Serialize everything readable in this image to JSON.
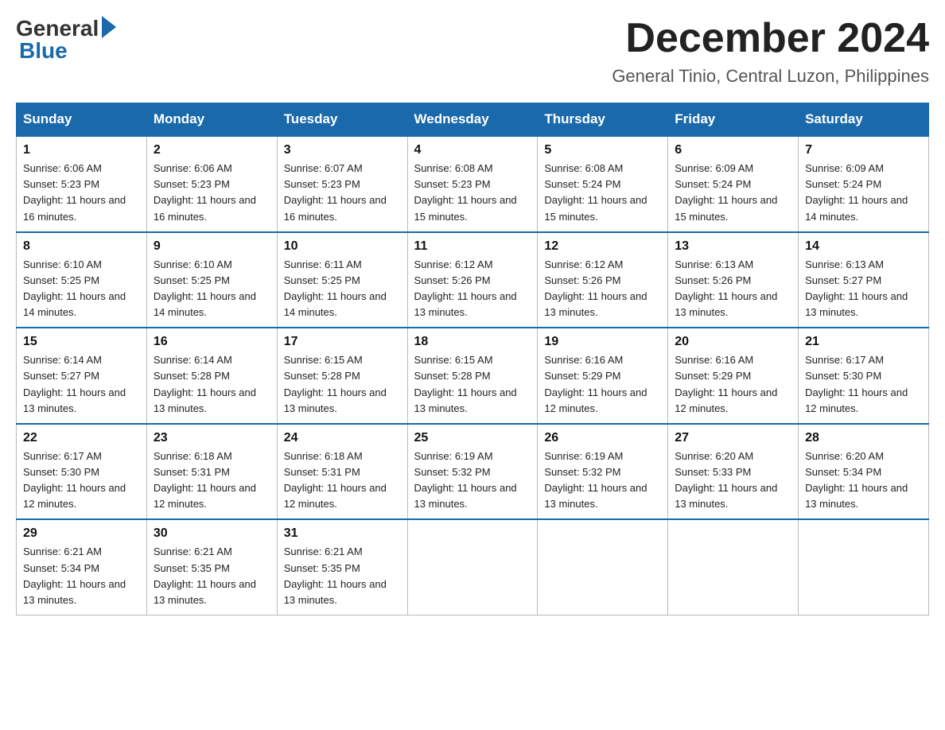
{
  "logo": {
    "general": "General",
    "blue": "Blue"
  },
  "header": {
    "month": "December 2024",
    "location": "General Tinio, Central Luzon, Philippines"
  },
  "days": [
    "Sunday",
    "Monday",
    "Tuesday",
    "Wednesday",
    "Thursday",
    "Friday",
    "Saturday"
  ],
  "weeks": [
    [
      {
        "day": "1",
        "sunrise": "6:06 AM",
        "sunset": "5:23 PM",
        "daylight": "11 hours and 16 minutes."
      },
      {
        "day": "2",
        "sunrise": "6:06 AM",
        "sunset": "5:23 PM",
        "daylight": "11 hours and 16 minutes."
      },
      {
        "day": "3",
        "sunrise": "6:07 AM",
        "sunset": "5:23 PM",
        "daylight": "11 hours and 16 minutes."
      },
      {
        "day": "4",
        "sunrise": "6:08 AM",
        "sunset": "5:23 PM",
        "daylight": "11 hours and 15 minutes."
      },
      {
        "day": "5",
        "sunrise": "6:08 AM",
        "sunset": "5:24 PM",
        "daylight": "11 hours and 15 minutes."
      },
      {
        "day": "6",
        "sunrise": "6:09 AM",
        "sunset": "5:24 PM",
        "daylight": "11 hours and 15 minutes."
      },
      {
        "day": "7",
        "sunrise": "6:09 AM",
        "sunset": "5:24 PM",
        "daylight": "11 hours and 14 minutes."
      }
    ],
    [
      {
        "day": "8",
        "sunrise": "6:10 AM",
        "sunset": "5:25 PM",
        "daylight": "11 hours and 14 minutes."
      },
      {
        "day": "9",
        "sunrise": "6:10 AM",
        "sunset": "5:25 PM",
        "daylight": "11 hours and 14 minutes."
      },
      {
        "day": "10",
        "sunrise": "6:11 AM",
        "sunset": "5:25 PM",
        "daylight": "11 hours and 14 minutes."
      },
      {
        "day": "11",
        "sunrise": "6:12 AM",
        "sunset": "5:26 PM",
        "daylight": "11 hours and 13 minutes."
      },
      {
        "day": "12",
        "sunrise": "6:12 AM",
        "sunset": "5:26 PM",
        "daylight": "11 hours and 13 minutes."
      },
      {
        "day": "13",
        "sunrise": "6:13 AM",
        "sunset": "5:26 PM",
        "daylight": "11 hours and 13 minutes."
      },
      {
        "day": "14",
        "sunrise": "6:13 AM",
        "sunset": "5:27 PM",
        "daylight": "11 hours and 13 minutes."
      }
    ],
    [
      {
        "day": "15",
        "sunrise": "6:14 AM",
        "sunset": "5:27 PM",
        "daylight": "11 hours and 13 minutes."
      },
      {
        "day": "16",
        "sunrise": "6:14 AM",
        "sunset": "5:28 PM",
        "daylight": "11 hours and 13 minutes."
      },
      {
        "day": "17",
        "sunrise": "6:15 AM",
        "sunset": "5:28 PM",
        "daylight": "11 hours and 13 minutes."
      },
      {
        "day": "18",
        "sunrise": "6:15 AM",
        "sunset": "5:28 PM",
        "daylight": "11 hours and 13 minutes."
      },
      {
        "day": "19",
        "sunrise": "6:16 AM",
        "sunset": "5:29 PM",
        "daylight": "11 hours and 12 minutes."
      },
      {
        "day": "20",
        "sunrise": "6:16 AM",
        "sunset": "5:29 PM",
        "daylight": "11 hours and 12 minutes."
      },
      {
        "day": "21",
        "sunrise": "6:17 AM",
        "sunset": "5:30 PM",
        "daylight": "11 hours and 12 minutes."
      }
    ],
    [
      {
        "day": "22",
        "sunrise": "6:17 AM",
        "sunset": "5:30 PM",
        "daylight": "11 hours and 12 minutes."
      },
      {
        "day": "23",
        "sunrise": "6:18 AM",
        "sunset": "5:31 PM",
        "daylight": "11 hours and 12 minutes."
      },
      {
        "day": "24",
        "sunrise": "6:18 AM",
        "sunset": "5:31 PM",
        "daylight": "11 hours and 12 minutes."
      },
      {
        "day": "25",
        "sunrise": "6:19 AM",
        "sunset": "5:32 PM",
        "daylight": "11 hours and 13 minutes."
      },
      {
        "day": "26",
        "sunrise": "6:19 AM",
        "sunset": "5:32 PM",
        "daylight": "11 hours and 13 minutes."
      },
      {
        "day": "27",
        "sunrise": "6:20 AM",
        "sunset": "5:33 PM",
        "daylight": "11 hours and 13 minutes."
      },
      {
        "day": "28",
        "sunrise": "6:20 AM",
        "sunset": "5:34 PM",
        "daylight": "11 hours and 13 minutes."
      }
    ],
    [
      {
        "day": "29",
        "sunrise": "6:21 AM",
        "sunset": "5:34 PM",
        "daylight": "11 hours and 13 minutes."
      },
      {
        "day": "30",
        "sunrise": "6:21 AM",
        "sunset": "5:35 PM",
        "daylight": "11 hours and 13 minutes."
      },
      {
        "day": "31",
        "sunrise": "6:21 AM",
        "sunset": "5:35 PM",
        "daylight": "11 hours and 13 minutes."
      },
      null,
      null,
      null,
      null
    ]
  ]
}
